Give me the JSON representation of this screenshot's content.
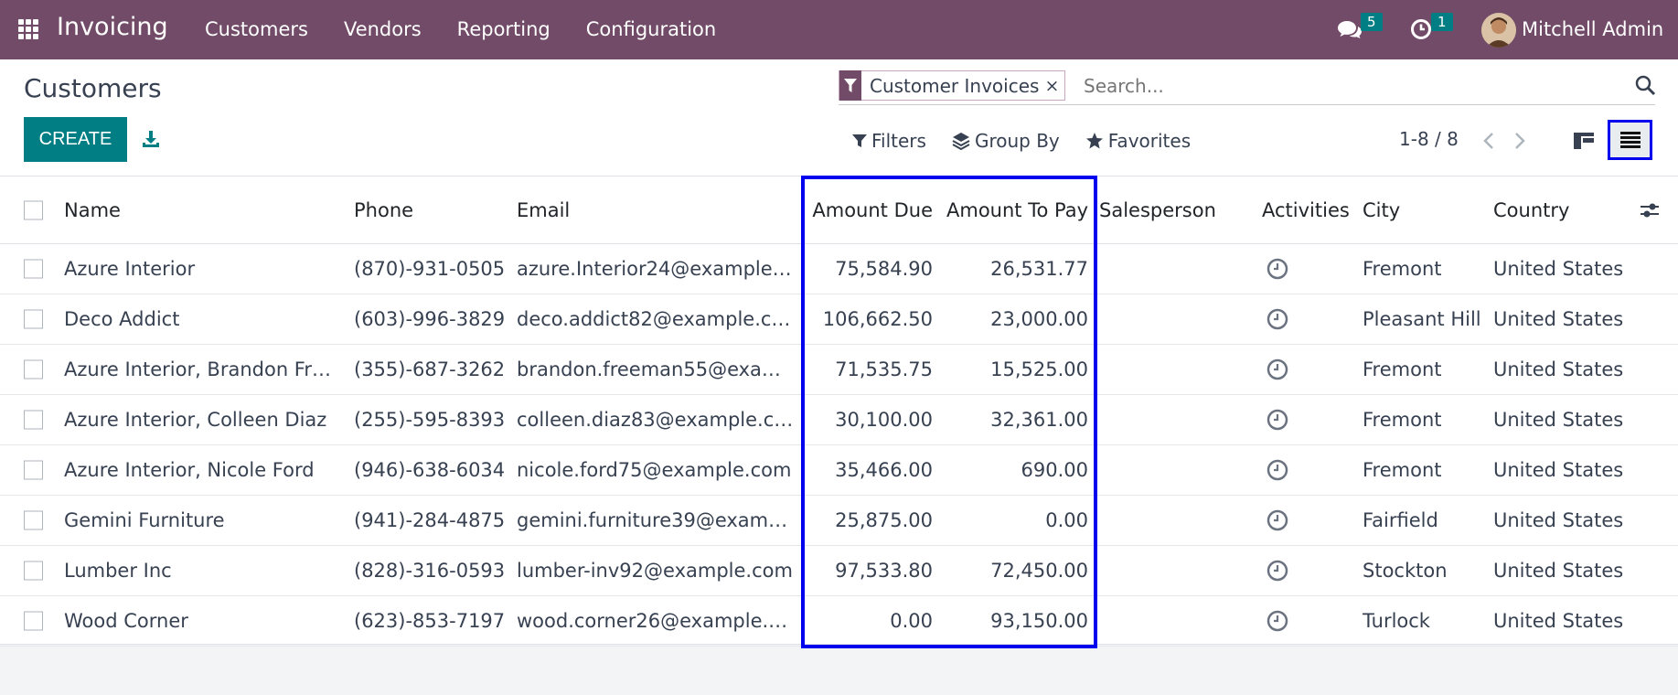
{
  "nav": {
    "app_name": "Invoicing",
    "menu": [
      "Customers",
      "Vendors",
      "Reporting",
      "Configuration"
    ],
    "messages_count": "5",
    "activities_count": "1",
    "user_name": "Mitchell Admin",
    "brand_color": "#714b67"
  },
  "control": {
    "breadcrumb": "Customers",
    "create_label": "CREATE",
    "facet_label": "Customer Invoices",
    "facet_close": "×",
    "search_placeholder": "Search...",
    "filters_label": "Filters",
    "groupby_label": "Group By",
    "favorites_label": "Favorites",
    "pager": "1-8 / 8",
    "accent_color": "#017e84"
  },
  "table": {
    "columns": {
      "name": "Name",
      "phone": "Phone",
      "email": "Email",
      "amount_due": "Amount Due",
      "amount_to_pay": "Amount To Pay",
      "salesperson": "Salesperson",
      "activities": "Activities",
      "city": "City",
      "country": "Country"
    },
    "rows": [
      {
        "name": "Azure Interior",
        "phone": "(870)-931-0505",
        "email": "azure.Interior24@example…",
        "amount_due": "75,584.90",
        "amount_to_pay": "26,531.77",
        "salesperson": "",
        "city": "Fremont",
        "country": "United States"
      },
      {
        "name": "Deco Addict",
        "phone": "(603)-996-3829",
        "email": "deco.addict82@example.c…",
        "amount_due": "106,662.50",
        "amount_to_pay": "23,000.00",
        "salesperson": "",
        "city": "Pleasant Hill",
        "country": "United States"
      },
      {
        "name": "Azure Interior, Brandon Fr…",
        "phone": "(355)-687-3262",
        "email": "brandon.freeman55@exa…",
        "amount_due": "71,535.75",
        "amount_to_pay": "15,525.00",
        "salesperson": "",
        "city": "Fremont",
        "country": "United States"
      },
      {
        "name": "Azure Interior, Colleen Diaz",
        "phone": "(255)-595-8393",
        "email": "colleen.diaz83@example.c…",
        "amount_due": "30,100.00",
        "amount_to_pay": "32,361.00",
        "salesperson": "",
        "city": "Fremont",
        "country": "United States"
      },
      {
        "name": "Azure Interior, Nicole Ford",
        "phone": "(946)-638-6034",
        "email": "nicole.ford75@example.com",
        "amount_due": "35,466.00",
        "amount_to_pay": "690.00",
        "salesperson": "",
        "city": "Fremont",
        "country": "United States"
      },
      {
        "name": "Gemini Furniture",
        "phone": "(941)-284-4875",
        "email": "gemini.furniture39@exam…",
        "amount_due": "25,875.00",
        "amount_to_pay": "0.00",
        "salesperson": "",
        "city": "Fairfield",
        "country": "United States"
      },
      {
        "name": "Lumber Inc",
        "phone": "(828)-316-0593",
        "email": "lumber-inv92@example.com",
        "amount_due": "97,533.80",
        "amount_to_pay": "72,450.00",
        "salesperson": "",
        "city": "Stockton",
        "country": "United States"
      },
      {
        "name": "Wood Corner",
        "phone": "(623)-853-7197",
        "email": "wood.corner26@example.…",
        "amount_due": "0.00",
        "amount_to_pay": "93,150.00",
        "salesperson": "",
        "city": "Turlock",
        "country": "United States"
      }
    ]
  },
  "highlight_color": "#0000ee"
}
